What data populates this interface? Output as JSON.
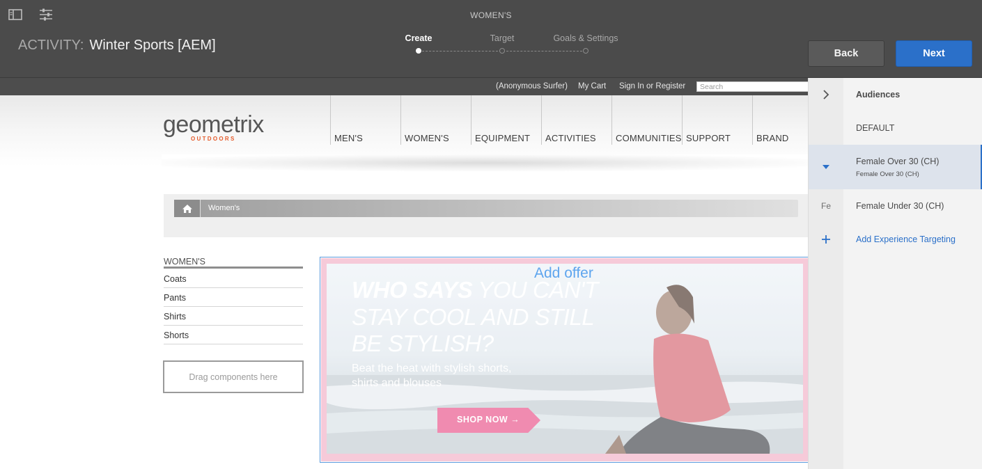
{
  "header": {
    "page_title": "WOMEN'S",
    "activity_prefix": "ACTIVITY:",
    "activity_name": "Winter Sports [AEM]",
    "steps": [
      {
        "label": "Create",
        "active": true
      },
      {
        "label": "Target",
        "active": false
      },
      {
        "label": "Goals & Settings",
        "active": false
      }
    ],
    "back_label": "Back",
    "next_label": "Next",
    "icons": [
      "side-panel-icon",
      "properties-icon"
    ],
    "colors": {
      "bar": "#4b4b4b",
      "primary": "#2b70c9"
    }
  },
  "site": {
    "util_links": [
      "(Anonymous Surfer)",
      "My Cart",
      "Sign In or Register"
    ],
    "search_placeholder": "Search",
    "logo_text": "geometrix",
    "logo_sub": "OUTDOORS",
    "nav": [
      "MEN'S",
      "WOMEN'S",
      "EQUIPMENT",
      "ACTIVITIES",
      "COMMUNITIES",
      "SUPPORT",
      "BRAND"
    ],
    "breadcrumb": "Women's",
    "sidebar_heading": "WOMEN'S",
    "sidebar_items": [
      "Coats",
      "Pants",
      "Shirts",
      "Shorts"
    ],
    "dropzone_label": "Drag components here",
    "banner": {
      "add_offer": "Add offer",
      "headline_bold": "WHO SAYS",
      "headline_rest": " YOU CAN'T",
      "headline_line2": "STAY COOL AND STILL",
      "headline_line3": "BE STYLISH?",
      "sub_line1": "Beat the heat with stylish shorts,",
      "sub_line2": "shirts and blouses",
      "cta": "SHOP NOW →"
    }
  },
  "rail": {
    "audiences_label": "Audiences",
    "default_label": "DEFAULT",
    "selected_title": "Female Over 30 (CH)",
    "selected_sub": "Female Over 30 (CH)",
    "other_abbrev": "Fe",
    "other_label": "Female Under 30 (CH)",
    "add_label": "Add Experience Targeting"
  }
}
